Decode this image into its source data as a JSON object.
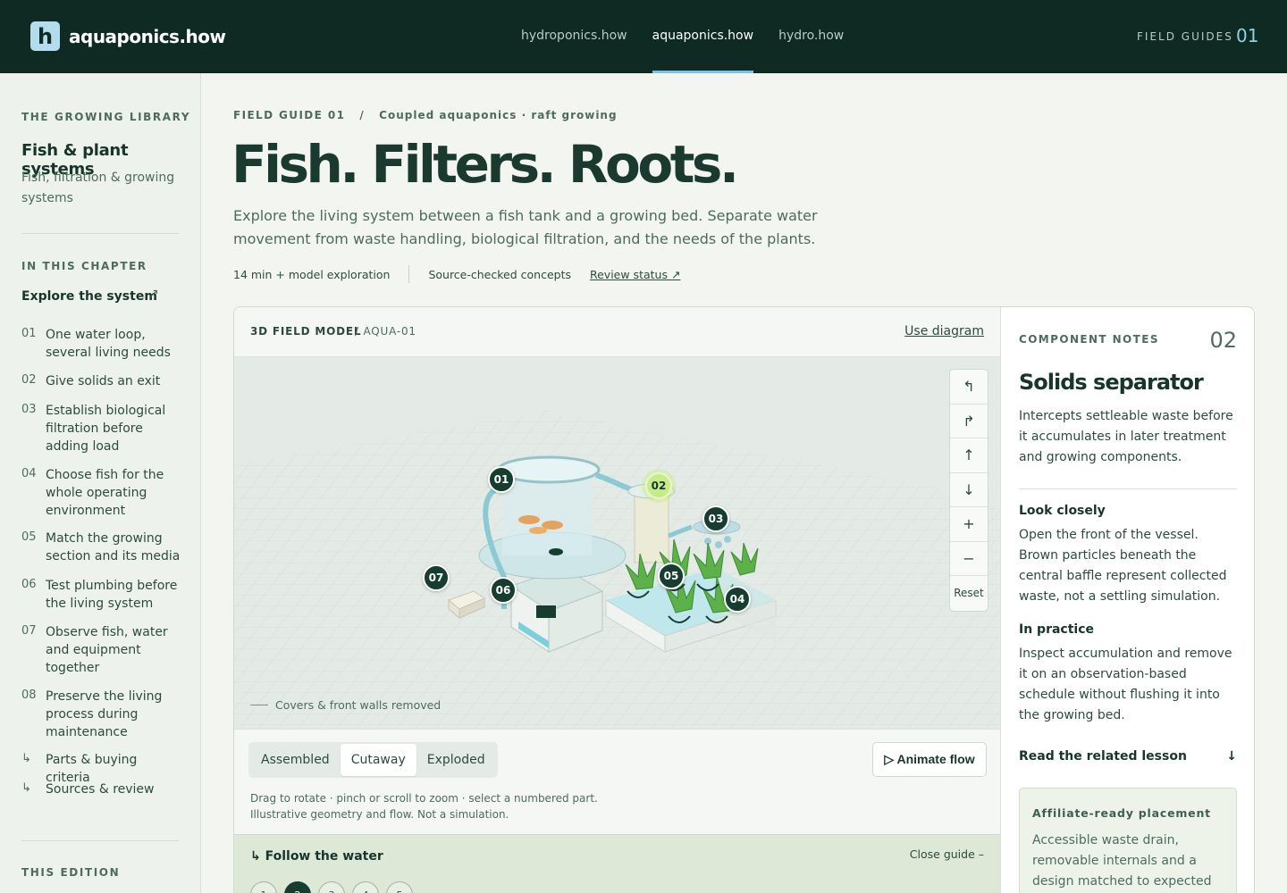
{
  "brand": {
    "mark": "h",
    "name": "aquaponics.how"
  },
  "nav": {
    "items": [
      "hydroponics.how",
      "aquaponics.how",
      "hydro.how"
    ],
    "active_index": 1,
    "field_guides_label": "FIELD GUIDES",
    "field_guides_number": "01"
  },
  "sidebar": {
    "library_kicker": "THE GROWING LIBRARY",
    "title": "Fish & plant systems",
    "subtitle": "Fish, filtration & growing systems",
    "chapter_kicker": "IN THIS CHAPTER",
    "explore_label": "Explore the system",
    "explore_icon": "arrow-up-right-icon",
    "chapters": [
      {
        "num": "01",
        "text": "One water loop, several living needs"
      },
      {
        "num": "02",
        "text": "Give solids an exit"
      },
      {
        "num": "03",
        "text": "Establish biological filtration before adding load"
      },
      {
        "num": "04",
        "text": "Choose fish for the whole operating environment"
      },
      {
        "num": "05",
        "text": "Match the growing section and its media"
      },
      {
        "num": "06",
        "text": "Test plumbing before the living system"
      },
      {
        "num": "07",
        "text": "Observe fish, water and equipment together"
      },
      {
        "num": "08",
        "text": "Preserve the living process during maintenance"
      },
      {
        "num": "↳",
        "text": "Parts & buying criteria"
      },
      {
        "num": "↳",
        "text": "Sources & review"
      }
    ],
    "edition_kicker": "THIS EDITION"
  },
  "header": {
    "guide_label": "FIELD GUIDE 01",
    "separator": "/",
    "section_label": "Coupled aquaponics · raft growing",
    "title": "Fish. Filters. Roots.",
    "lede": "Explore the living system between a fish tank and a growing bed. Separate water movement from waste handling, biological filtration, and the needs of the plants.",
    "meta": {
      "read_time": "14 min + model exploration",
      "sources": "Source-checked concepts",
      "review_link": "Review status ↗"
    }
  },
  "model": {
    "title": "3D FIELD MODEL",
    "sub": "/ AQUA-01",
    "diagram_link": "Use diagram",
    "caption": "Covers & front walls removed",
    "pins": [
      "01",
      "02",
      "03",
      "04",
      "05",
      "06",
      "07"
    ],
    "selected_pin": "02",
    "controls": [
      "↰",
      "↱",
      "↑",
      "↓",
      "+",
      "−",
      "Reset"
    ],
    "control_icons": [
      "rotate-left-icon",
      "rotate-right-icon",
      "tilt-up-icon",
      "tilt-down-icon",
      "zoom-in-icon",
      "zoom-out-icon",
      "reset-view"
    ],
    "modes": [
      "Assembled",
      "Cutaway",
      "Exploded"
    ],
    "active_mode": "Cutaway",
    "animate_label": "▷ Animate flow",
    "hint_line1": "Drag to rotate · pinch or scroll to zoom · select a numbered part.",
    "hint_line2": "Illustrative geometry and flow. Not a simulation.",
    "follow_title": "↳ Follow the water",
    "follow_close": "Close guide –",
    "steps": [
      "1",
      "2",
      "3",
      "4",
      "5"
    ],
    "active_step": "2"
  },
  "notes": {
    "kicker": "COMPONENT NOTES",
    "number": "02",
    "title": "Solids separator",
    "intro": "Intercepts settleable waste before it accumulates in later treatment and growing components.",
    "look_heading": "Look closely",
    "look_body": "Open the front of the vessel. Brown particles beneath the central baffle represent collected waste, not a settling simulation.",
    "practice_heading": "In practice",
    "practice_body": "Inspect accumulation and remove it on an observation-based schedule without flushing it into the growing bed.",
    "read_link": "Read the related lesson",
    "read_icon": "arrow-down-icon",
    "affiliate_title": "Affiliate-ready placement",
    "affiliate_body": "Accessible waste drain, removable internals and a design matched to expected solids and"
  },
  "colors": {
    "topbar": "#0e2a22",
    "accent": "#7cc3df",
    "selected_pin": "#c7ec87",
    "pin": "#173d31",
    "water": "#8fd4e0"
  }
}
